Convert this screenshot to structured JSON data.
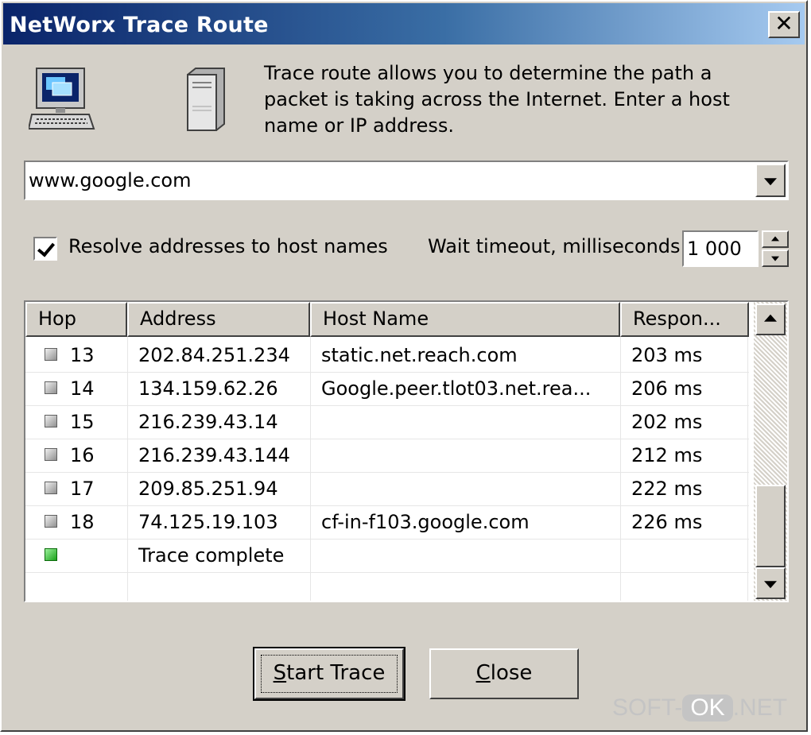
{
  "window": {
    "title": "NetWorx Trace Route",
    "close_glyph": "✕"
  },
  "description": "Trace route allows you to determine the path a packet is taking across the Internet. Enter a host name or IP address.",
  "host_input": {
    "value": "www.google.com"
  },
  "options": {
    "resolve_label": "Resolve addresses to host names",
    "resolve_checked": true,
    "timeout_label": "Wait timeout, milliseconds",
    "timeout_value": "1 000"
  },
  "table": {
    "columns": [
      "Hop",
      "Address",
      "Host Name",
      "Respon..."
    ],
    "rows": [
      {
        "status": "gray",
        "hop": "13",
        "address": "202.84.251.234",
        "host": "static.net.reach.com",
        "response": "203 ms"
      },
      {
        "status": "gray",
        "hop": "14",
        "address": "134.159.62.26",
        "host": "Google.peer.tlot03.net.rea...",
        "response": "206 ms"
      },
      {
        "status": "gray",
        "hop": "15",
        "address": "216.239.43.14",
        "host": "",
        "response": "202 ms"
      },
      {
        "status": "gray",
        "hop": "16",
        "address": "216.239.43.144",
        "host": "",
        "response": "212 ms"
      },
      {
        "status": "gray",
        "hop": "17",
        "address": "209.85.251.94",
        "host": "",
        "response": "222 ms"
      },
      {
        "status": "gray",
        "hop": "18",
        "address": "74.125.19.103",
        "host": "cf-in-f103.google.com",
        "response": "226 ms"
      },
      {
        "status": "green",
        "hop": "",
        "address": "Trace complete",
        "host": "",
        "response": ""
      }
    ]
  },
  "buttons": {
    "start_first": "S",
    "start_rest": "tart Trace",
    "close_first": "C",
    "close_rest": "lose"
  },
  "watermark": {
    "left": "SOFT-",
    "mid": "OK",
    "right": ".NET"
  }
}
